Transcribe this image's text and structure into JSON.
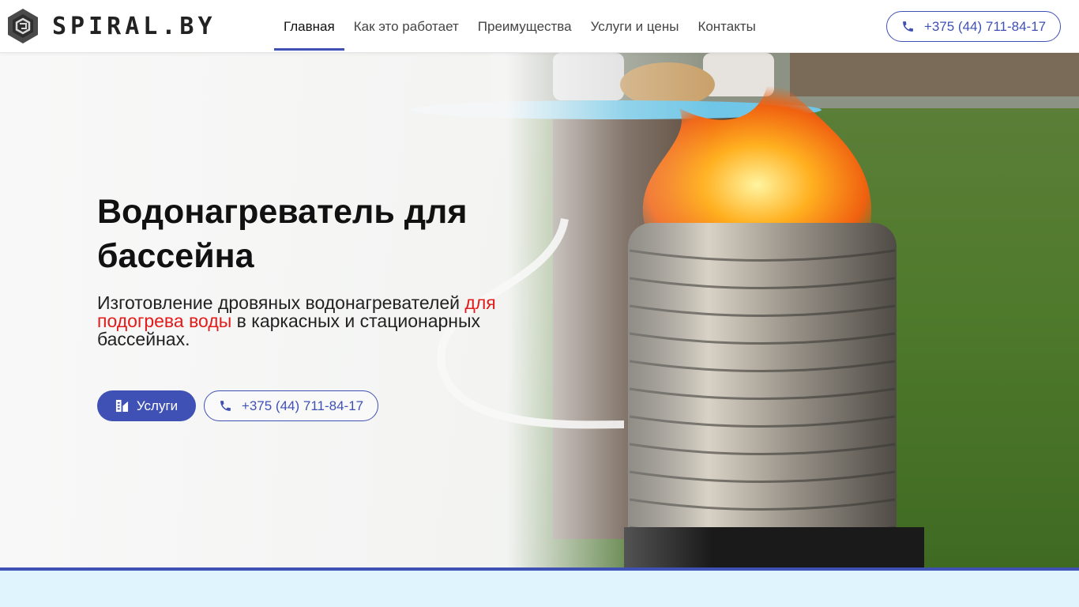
{
  "header": {
    "logo_text": "SPIRAL.BY",
    "nav": [
      {
        "label": "Главная",
        "active": true
      },
      {
        "label": "Как это работает",
        "active": false
      },
      {
        "label": "Преимущества",
        "active": false
      },
      {
        "label": "Услуги и цены",
        "active": false
      },
      {
        "label": "Контакты",
        "active": false
      }
    ],
    "phone": "+375 (44) 711-84-17"
  },
  "hero": {
    "title": "Водонагреватель для бассейна",
    "subtitle_part1": "Изготовление дровяных водонагревателей ",
    "subtitle_highlight": "для подогрева воды",
    "subtitle_part2": " в каркасных и стационарных бассейнах.",
    "services_button": "Услуги",
    "phone_button": "+375 (44) 711-84-17"
  },
  "colors": {
    "accent": "#3f51b5",
    "highlight": "#e21b1b",
    "bottom_band": "#dff4fc"
  },
  "icons": [
    "logo-hexagon-icon",
    "phone-icon",
    "services-icon"
  ]
}
